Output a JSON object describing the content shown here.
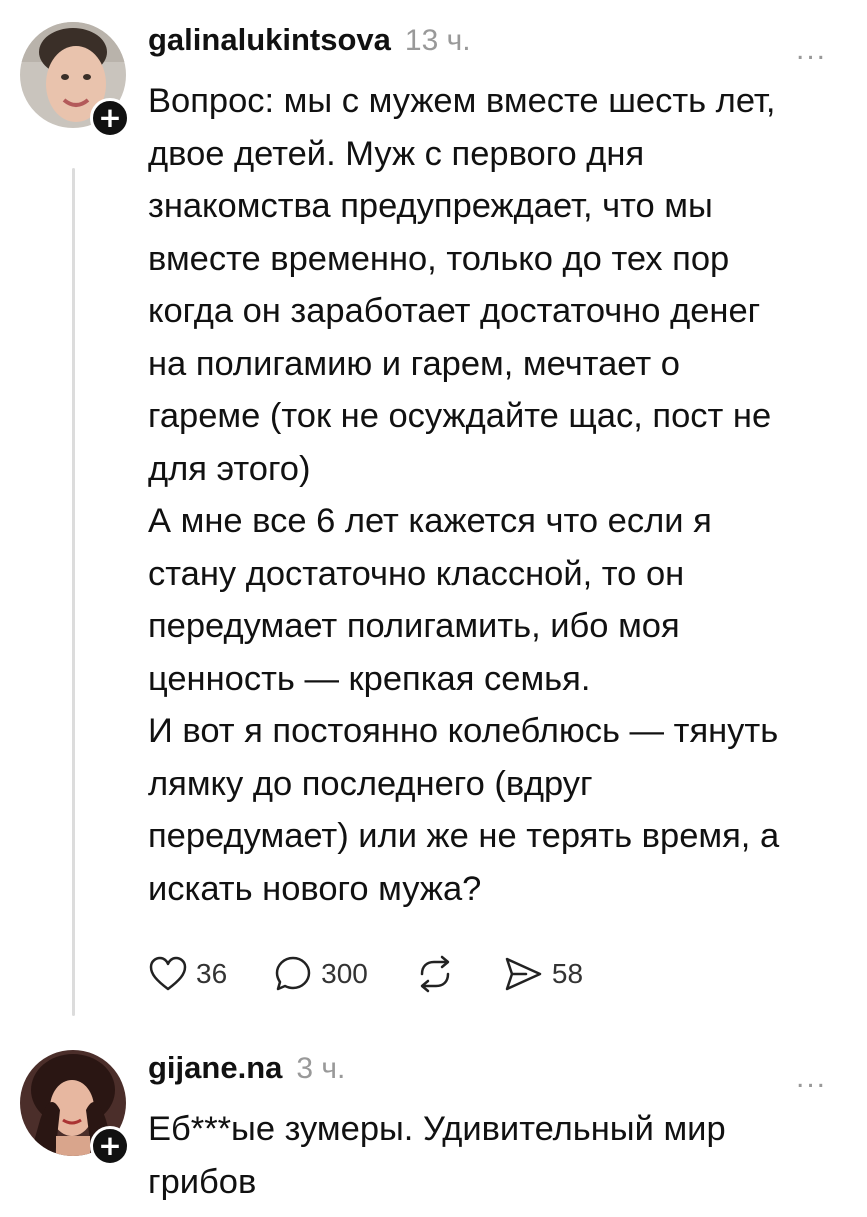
{
  "posts": [
    {
      "username": "galinalukintsova",
      "time": "13 ч.",
      "more_label": "...",
      "follow_label": "+",
      "text": "Вопрос: мы с мужем вместе шесть лет,\nдвое детей. Муж с первого дня\nзнакомства предупреждает, что мы\nвместе временно, только до тех пор\nкогда он заработает достаточно денег\nна полигамию и гарем, мечтает о\nгареме (ток не осуждайте щас, пост не\nдля этого)\nА мне все 6 лет кажется что если я\nстану достаточно классной, то он\nпередумает полигамить, ибо моя\nценность — крепкая семья.\nИ вот я постоянно колеблюсь — тянуть\nлямку до последнего (вдруг\nпередумает) или же не терять время, а\nискать нового мужа?",
      "likes": "36",
      "comments": "300",
      "shares": "58",
      "icons": {
        "like": "heart-icon",
        "comment": "comment-icon",
        "repost": "repost-icon",
        "share": "send-icon"
      }
    },
    {
      "username": "gijane.na",
      "time": "3 ч.",
      "more_label": "...",
      "follow_label": "+",
      "text": "Еб***ые зумеры. Удивительный мир\nгрибов"
    }
  ],
  "colors": {
    "text": "#111111",
    "muted": "#999999",
    "thread_line": "#dcdcdc"
  }
}
